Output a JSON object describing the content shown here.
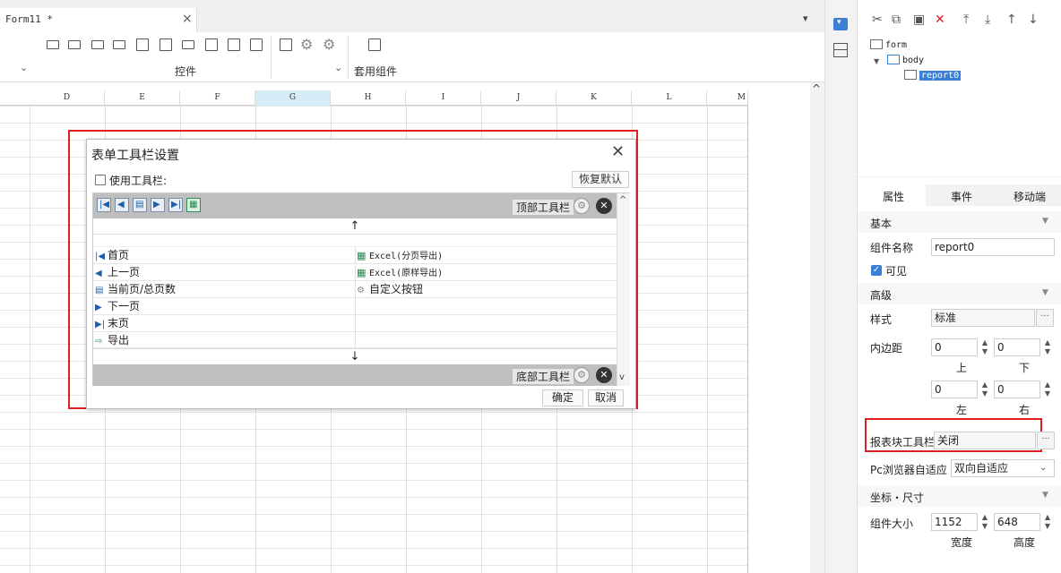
{
  "editor": {
    "tab_title": "Form11 *",
    "tab_close": "×",
    "tab_menu": "▾",
    "toolbar": {
      "group_controls": "控件",
      "group_suite": "套用组件"
    },
    "columns": [
      "D",
      "E",
      "F",
      "G",
      "H",
      "I",
      "J",
      "K",
      "L",
      "M"
    ],
    "selected_column": "G"
  },
  "dialog": {
    "title": "表单工具栏设置",
    "use_toolbar_label": "使用工具栏:",
    "use_toolbar_checked": false,
    "restore_default": "恢复默认",
    "top_toolbar_label": "顶部工具栏",
    "bottom_toolbar_label": "底部工具栏",
    "up_arrow": "↑",
    "down_arrow": "↓",
    "left_items": [
      {
        "icon": "first-page-icon",
        "glyph": "|◀",
        "label": "首页"
      },
      {
        "icon": "prev-page-icon",
        "glyph": "◀",
        "label": "上一页"
      },
      {
        "icon": "page-count-icon",
        "glyph": "▤",
        "label": "当前页/总页数"
      },
      {
        "icon": "next-page-icon",
        "glyph": "▶",
        "label": "下一页"
      },
      {
        "icon": "last-page-icon",
        "glyph": "▶|",
        "label": "末页"
      },
      {
        "icon": "export-icon",
        "glyph": "⇨",
        "label": "导出"
      }
    ],
    "right_items": [
      {
        "icon": "excel-icon",
        "glyph": "▦",
        "label": "Excel(分页导出)"
      },
      {
        "icon": "excel-icon",
        "glyph": "▦",
        "label": "Excel(原样导出)"
      },
      {
        "icon": "gear-icon",
        "glyph": "⚙",
        "label": "自定义按钮"
      }
    ],
    "ok": "确定",
    "cancel": "取消"
  },
  "panel": {
    "tree": {
      "form": "form",
      "body": "body",
      "report": "report0"
    },
    "tabs": {
      "attributes": "属性",
      "events": "事件",
      "mobile": "移动端"
    },
    "sections": {
      "basic": "基本",
      "advanced": "高级",
      "position_size": "坐标・尺寸"
    },
    "component_name_label": "组件名称",
    "component_name_value": "report0",
    "visible_label": "可见",
    "visible_checked": true,
    "style_label": "样式",
    "style_value": "标准",
    "padding_label": "内边距",
    "padding": {
      "top": "0",
      "bottom": "0",
      "left": "0",
      "right": "0"
    },
    "padding_sub": {
      "top": "上",
      "bottom": "下",
      "left": "左",
      "right": "右"
    },
    "report_toolbar_label": "报表块工具栏",
    "report_toolbar_value": "关闭",
    "pc_adapt_label": "Pc浏览器自适应",
    "pc_adapt_value": "双向自适应",
    "size_label": "组件大小",
    "width_value": "1152",
    "height_value": "648",
    "width_label": "宽度",
    "height_label": "高度",
    "ellipsis": "···"
  },
  "colors": {
    "highlight_red": "#e02020",
    "accent_blue": "#3a7fd5",
    "toolbar_bar_gray": "#bfbfbf"
  }
}
